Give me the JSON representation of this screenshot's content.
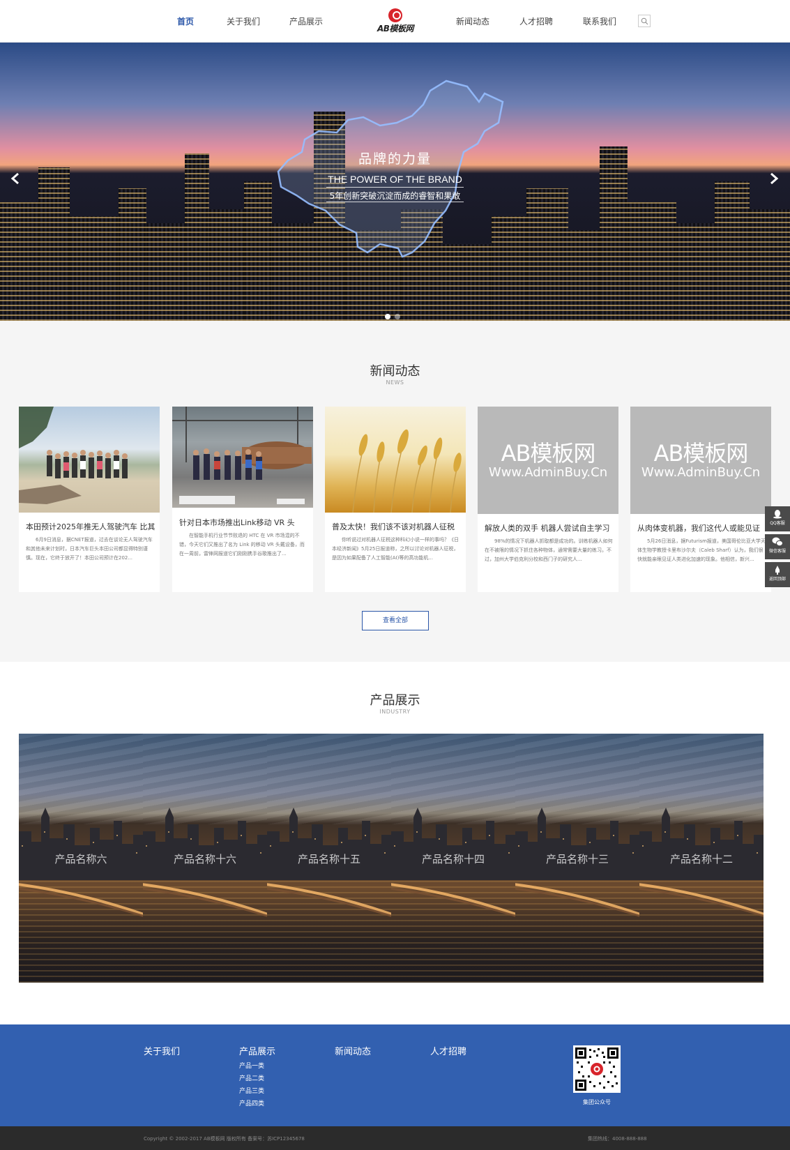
{
  "nav": {
    "items": [
      "首页",
      "关于我们",
      "产品展示",
      "新闻动态",
      "人才招聘",
      "联系我们"
    ],
    "active": "首页",
    "logo_text": "AB模板网",
    "search_icon": "search-icon"
  },
  "banner": {
    "title": "品牌的力量",
    "subtitle": "THE POWER OF THE BRAND",
    "tagline": "5年创新突破沉淀而成的睿智和果敢",
    "slide_count": 2,
    "active_slide": 1
  },
  "news": {
    "title": "新闻动态",
    "subtitle": "NEWS",
    "view_all": "查看全部",
    "watermark_main": "AB模板网",
    "watermark_sub": "Www.AdminBuy.Cn",
    "items": [
      {
        "title": "本田预计2025年推无人驾驶汽车 比其",
        "desc": "6月9日消息，据CNET报道，过去在谈论无人驾驶汽车和其他未来计划时，日本汽车巨头本田公司都显得特别谨慎。现在，它终于放开了！本田公司预计在202...",
        "image": "photo"
      },
      {
        "title": "针对日本市场推出Link移动 VR 头",
        "desc": "在智能手机行业节节败退的 HTC 在 VR 市场混的不错，今天它们又推出了名为 Link 的移动 VR 头戴设备，而在一周前，雷锋网报道它们刚刚携手谷歌推出了...",
        "image": "photo"
      },
      {
        "title": "普及太快！我们该不该对机器人征税",
        "desc": "你听说过对机器人征税这种科幻小说一样的事吗？《日本经济新闻》5月25日报道称，之所以讨论对机器人征税，是因为如果配备了人工智能(AI)等的高功能机...",
        "image": "photo"
      },
      {
        "title": "解放人类的双手 机器人尝试自主学习",
        "desc": "98%的情况下机器人抓取都是成功的。训练机器人如何在不被限的情况下抓住各种物体，通常需要大量的练习。不过，加州大学伯克利分校和西门子的研究人...",
        "image": "watermark"
      },
      {
        "title": "从肉体变机器，我们这代人或能见证",
        "desc": "5月26日消息，据Futurism报道，美国哥伦比亚大学天体生物学教授卡里布沙尔夫（Caleb Sharf）认为，我们很快就能亲眼见证人类进化加速的现象。他相信，新兴...",
        "image": "watermark"
      }
    ]
  },
  "side_widgets": [
    "QQ客服",
    "微信客服",
    "返回顶部"
  ],
  "products": {
    "title": "产品展示",
    "subtitle": "INDUSTRY",
    "items": [
      "产品名称六",
      "产品名称十六",
      "产品名称十五",
      "产品名称十四",
      "产品名称十三",
      "产品名称十二"
    ]
  },
  "footer": {
    "columns": [
      {
        "title": "关于我们",
        "links": []
      },
      {
        "title": "产品展示",
        "links": [
          "产品一类",
          "产品二类",
          "产品三类",
          "产品四类"
        ]
      },
      {
        "title": "新闻动态",
        "links": []
      },
      {
        "title": "人才招聘",
        "links": []
      }
    ],
    "qr_caption": "集团公众号",
    "copyright": "Copyright © 2002-2017 AB模板网 版权所有 备案号：苏ICP12345678",
    "hotline": "集团热线：4008-888-888"
  },
  "colors": {
    "brand_blue": "#3260b0",
    "nav_active": "#2a56a8",
    "logo_red": "#d8242b"
  }
}
